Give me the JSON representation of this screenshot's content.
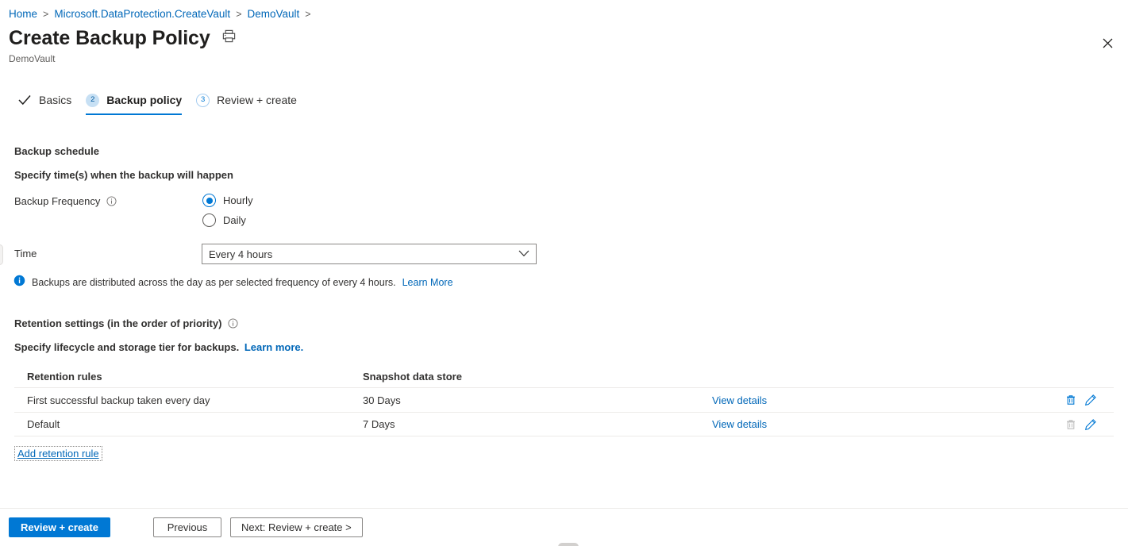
{
  "breadcrumb": {
    "items": [
      "Home",
      "Microsoft.DataProtection.CreateVault",
      "DemoVault"
    ],
    "separator": ">"
  },
  "header": {
    "title": "Create Backup Policy",
    "subtitle": "DemoVault",
    "print_icon": "printer-icon",
    "close_icon": "close-icon"
  },
  "wizard": {
    "tabs": [
      {
        "badge": "check",
        "label": "Basics",
        "state": "completed"
      },
      {
        "badge": "2",
        "label": "Backup policy",
        "state": "active"
      },
      {
        "badge": "3",
        "label": "Review + create",
        "state": "upcoming"
      }
    ]
  },
  "schedule": {
    "heading": "Backup schedule",
    "description": "Specify time(s) when the backup will happen",
    "frequency_label": "Backup Frequency",
    "frequency_info_icon": "info-circle-icon",
    "frequency_options": [
      "Hourly",
      "Daily"
    ],
    "frequency_selected": "Hourly",
    "time_label": "Time",
    "time_value": "Every 4 hours",
    "time_chevron_icon": "chevron-down-icon",
    "banner_icon": "info-filled-icon",
    "banner_text": "Backups are distributed across the day as per selected frequency of every 4 hours.",
    "banner_link": "Learn More"
  },
  "retention": {
    "heading": "Retention settings (in the order of priority)",
    "heading_info_icon": "info-circle-icon",
    "description": "Specify lifecycle and storage tier for backups.",
    "description_link": "Learn more.",
    "columns": [
      "Retention rules",
      "Snapshot data store"
    ],
    "rows": [
      {
        "rule": "First successful backup taken every day",
        "store": "30 Days",
        "details_link": "View details",
        "delete_icon": "trash-icon",
        "delete_enabled": true,
        "edit_icon": "pencil-icon"
      },
      {
        "rule": "Default",
        "store": "7 Days",
        "details_link": "View details",
        "delete_icon": "trash-icon",
        "delete_enabled": false,
        "edit_icon": "pencil-icon"
      }
    ],
    "add_rule_label": "Add retention rule"
  },
  "footer": {
    "review_create": "Review + create",
    "previous": "Previous",
    "next": "Next: Review + create >"
  },
  "colors": {
    "accent": "#0078d4",
    "link": "#0067b8",
    "badge_fill": "#c7e0f4",
    "disabled_icon": "#bdbdbd",
    "border": "#edebe9"
  }
}
